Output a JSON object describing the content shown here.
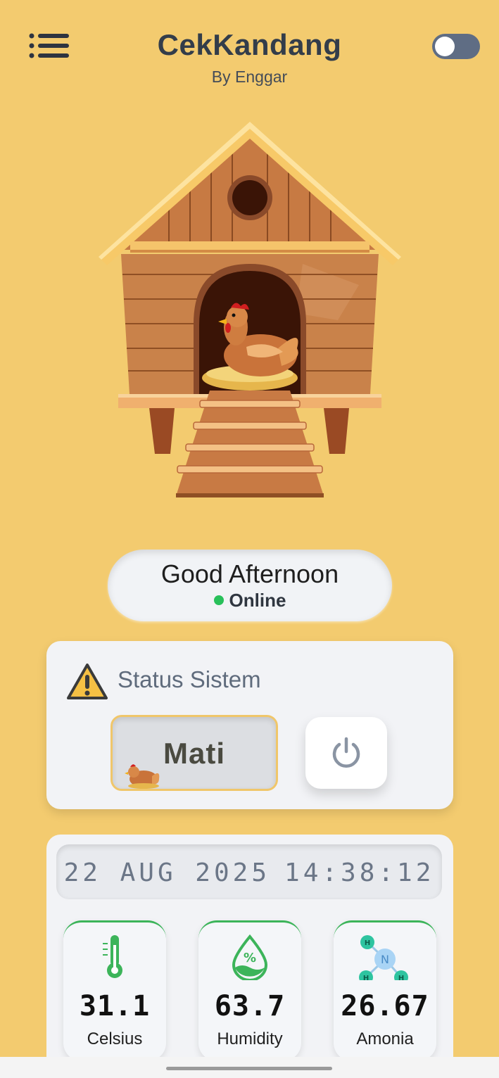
{
  "header": {
    "title": "CekKandang",
    "subtitle": "By Enggar"
  },
  "greeting": {
    "text": "Good Afternoon",
    "status": "Online",
    "status_color": "#28c05a"
  },
  "system_status": {
    "title": "Status Sistem",
    "state_label": "Mati",
    "accent": "#f0c66a"
  },
  "clock": {
    "date": "22 AUG 2025",
    "time": "14:38:12"
  },
  "sensors": [
    {
      "value": "31.1",
      "label": "Celsius",
      "icon": "thermometer-icon"
    },
    {
      "value": "63.7",
      "label": "Humidity",
      "icon": "humidity-drop-icon"
    },
    {
      "value": "26.67",
      "label": "Amonia",
      "icon": "ammonia-molecule-icon"
    }
  ],
  "colors": {
    "background": "#f3cb6f",
    "sensor_accent": "#3cb45a",
    "toggle": "#5f6d84"
  }
}
